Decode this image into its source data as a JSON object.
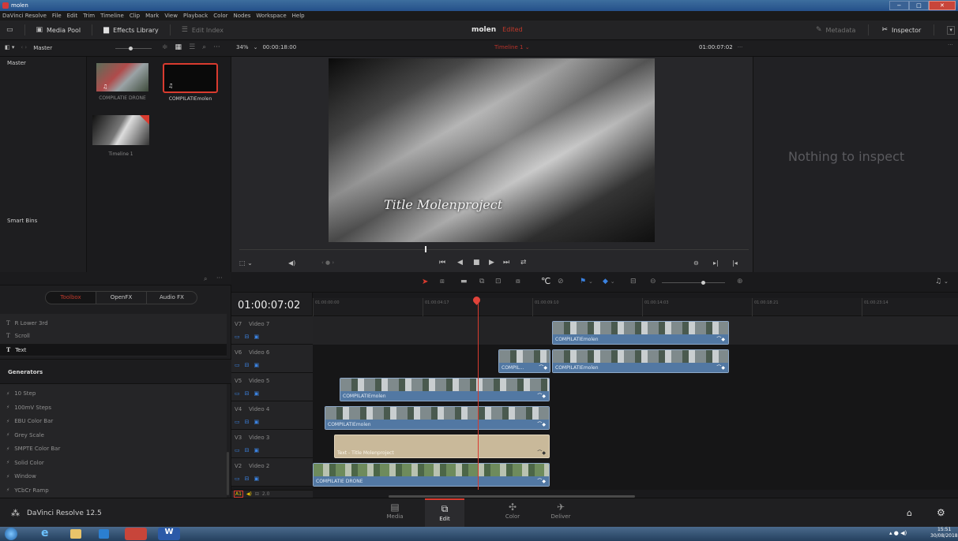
{
  "window": {
    "title": "molen",
    "controls": [
      "minimize",
      "maximize",
      "close"
    ]
  },
  "menu": [
    "DaVinci Resolve",
    "File",
    "Edit",
    "Trim",
    "Timeline",
    "Clip",
    "Mark",
    "View",
    "Playback",
    "Color",
    "Nodes",
    "Workspace",
    "Help"
  ],
  "toolbar": {
    "media_pool": "Media Pool",
    "effects_library": "Effects Library",
    "edit_index": "Edit Index",
    "project_name": "molen",
    "project_status": "Edited",
    "metadata": "Metadata",
    "inspector": "Inspector"
  },
  "toolbar2": {
    "bin": "Master",
    "zoom": "34%",
    "duration": "00:00:18:00",
    "timeline_name": "Timeline 1",
    "timecode": "01:00:07:02",
    "more": "···"
  },
  "bins": {
    "master": "Master",
    "smart_bins": "Smart Bins"
  },
  "media_items": [
    {
      "name": "COMPILATIE DRONE"
    },
    {
      "name": "COMPILATIEmolen"
    },
    {
      "name": "Timeline 1"
    }
  ],
  "viewer": {
    "overlay_title": "Title Molenproject"
  },
  "inspector_panel": {
    "empty_text": "Nothing to inspect"
  },
  "effects": {
    "tabs": [
      "Toolbox",
      "OpenFX",
      "Audio FX"
    ],
    "titles": [
      "R Lower 3rd",
      "Scroll",
      "Text"
    ],
    "generators_heading": "Generators",
    "generators": [
      "10 Step",
      "100mV Steps",
      "EBU Color Bar",
      "Grey Scale",
      "SMPTE Color Bar",
      "Solid Color",
      "Window",
      "YCbCr Ramp"
    ]
  },
  "timeline": {
    "timecode": "01:00:07:02",
    "ruler": [
      "01:00:00:00",
      "01:00:04:17",
      "01:00:09:10",
      "01:00:14:03",
      "01:00:18:21",
      "01:00:23:14"
    ],
    "tracks": [
      {
        "id": "V7",
        "name": "Video 7"
      },
      {
        "id": "V6",
        "name": "Video 6"
      },
      {
        "id": "V5",
        "name": "Video 5"
      },
      {
        "id": "V4",
        "name": "Video 4"
      },
      {
        "id": "V3",
        "name": "Video 3"
      },
      {
        "id": "V2",
        "name": "Video 2"
      }
    ],
    "audio_track": {
      "id": "A1",
      "level": "2.0"
    },
    "clips": {
      "v7": "COMPILATIEmolen",
      "v6a": "COMPIL...",
      "v6b": "COMPILATIEmolen",
      "v5": "COMPILATIEmolen",
      "v4": "COMPILATIEmolen",
      "v3": "Text - Title Molenproject",
      "v2": "COMPILATIE DRONE"
    }
  },
  "app_brand": "DaVinci Resolve 12.5",
  "pages": [
    "Media",
    "Edit",
    "Color",
    "Deliver"
  ],
  "active_page": "Edit",
  "taskbar": {
    "time": "15:51",
    "date": "30/08/2018"
  }
}
